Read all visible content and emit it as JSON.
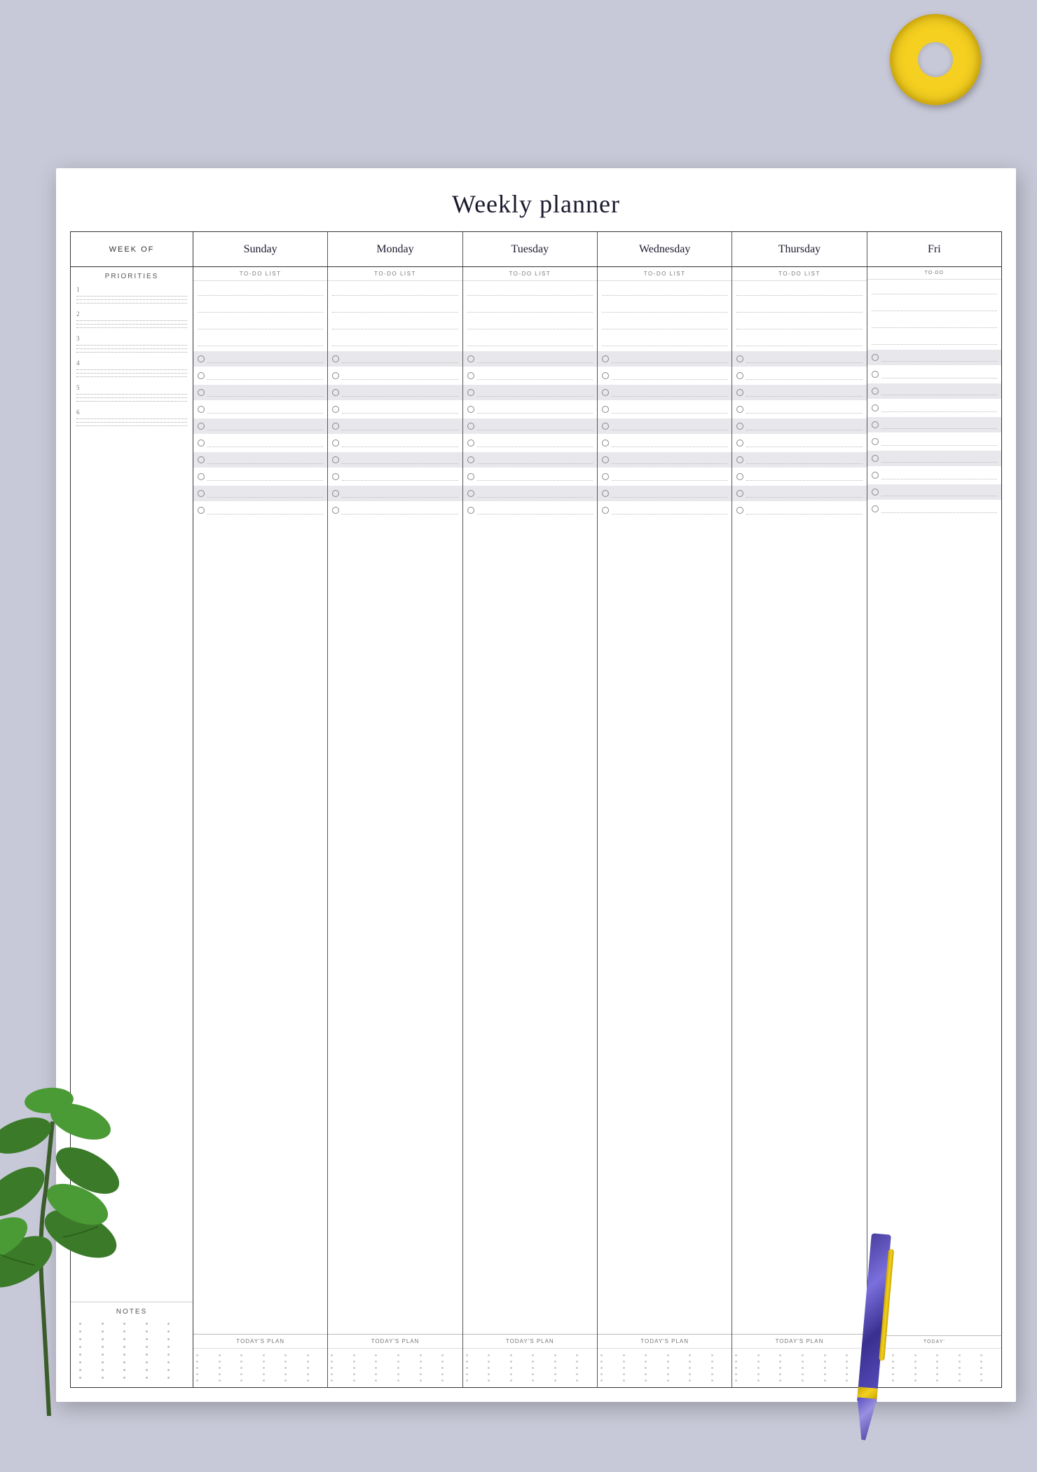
{
  "background_color": "#c8c9d8",
  "title": "Weekly planner",
  "header": {
    "week_of_label": "WEEK OF",
    "days": [
      "Sunday",
      "Monday",
      "Tuesday",
      "Wednesday",
      "Thursday",
      "Fri"
    ]
  },
  "columns": {
    "todo_label": "TO-DO LIST",
    "todays_plan_label": "TODAY'S PLAN",
    "todo_rows": 12
  },
  "sidebar": {
    "priorities_label": "PRIORITIES",
    "priorities": [
      {
        "num": "1"
      },
      {
        "num": "2"
      },
      {
        "num": "3"
      },
      {
        "num": "4"
      },
      {
        "num": "5"
      },
      {
        "num": "6"
      }
    ],
    "notes_label": "NOTES"
  }
}
